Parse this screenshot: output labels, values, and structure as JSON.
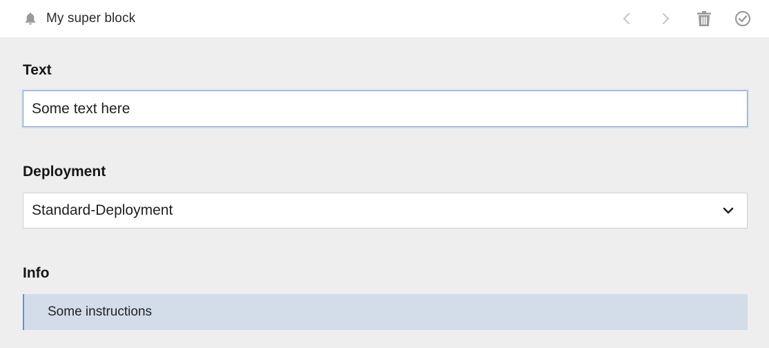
{
  "header": {
    "title": "My super block",
    "icons": {
      "bell": "bell-icon",
      "prev": "chevron-left-icon",
      "next": "chevron-right-icon",
      "delete": "trash-icon",
      "confirm": "check-circle-icon"
    }
  },
  "fields": {
    "text": {
      "label": "Text",
      "value": "Some text here"
    },
    "deployment": {
      "label": "Deployment",
      "selected": "Standard-Deployment"
    },
    "info": {
      "label": "Info",
      "message": "Some instructions"
    }
  },
  "colors": {
    "background": "#eeeeee",
    "header_bg": "#ffffff",
    "input_focus_border": "#7f9ec4",
    "info_bg": "#d3dde9",
    "info_border": "#6f8eb5",
    "icon_gray": "#9a9a9a"
  }
}
